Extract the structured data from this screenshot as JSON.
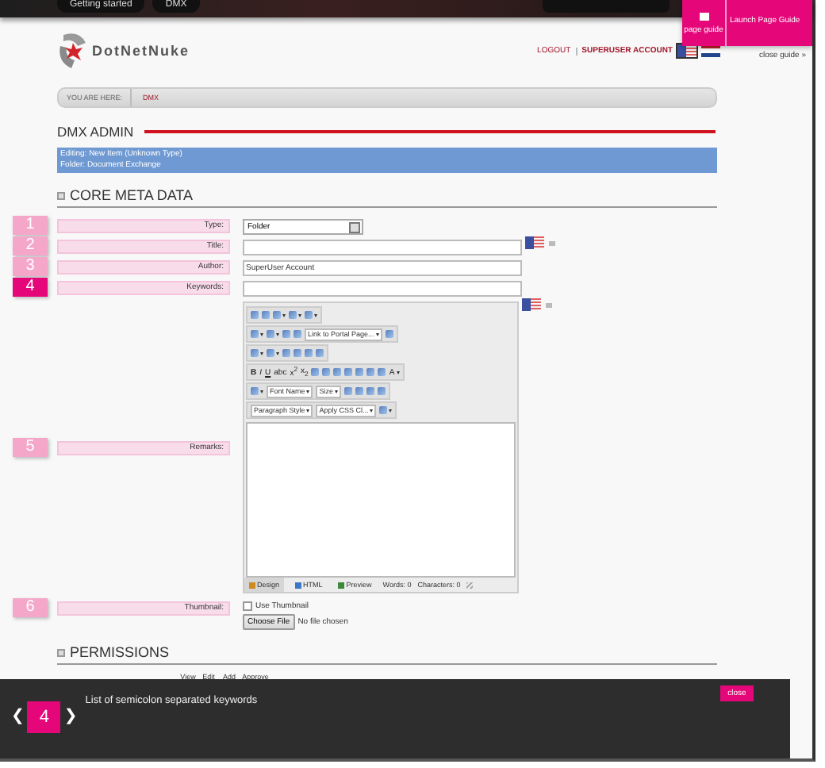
{
  "top_bar": {
    "menu": [
      "Getting started",
      "DMX"
    ]
  },
  "header": {
    "logo": "DotNetNuke",
    "links": [
      "LOGOUT",
      "SUPERUSER ACCOUNT"
    ],
    "languages": [
      {
        "kind": "us",
        "selected": true
      },
      {
        "kind": "nl",
        "selected": false
      }
    ]
  },
  "page_guide": {
    "button": "page guide",
    "launch": "Launch Page Guide",
    "close": "close guide »"
  },
  "breadcrumb": {
    "label": "YOU ARE HERE:",
    "items": [
      "DMX"
    ]
  },
  "title": "DMX ADMIN",
  "info": [
    "Editing: New Item (Unknown Type)",
    "Folder: Document Exchange"
  ],
  "core_meta": {
    "heading": "CORE META DATA",
    "fields": [
      {
        "label": "Type:",
        "kind": "select",
        "value": "Folder",
        "guide": {
          "number": "1",
          "selected": false
        }
      },
      {
        "label": "Title:",
        "kind": "text",
        "flag": true,
        "guide": {
          "number": "2",
          "selected": false
        }
      },
      {
        "label": "Author:",
        "kind": "text",
        "value": "SuperUser Account",
        "guide": {
          "number": "3",
          "selected": false
        }
      },
      {
        "label": "Keywords:",
        "kind": "text",
        "guide": {
          "number": "4",
          "selected": true
        }
      },
      {
        "label": "Remarks:",
        "kind": "editor",
        "flag": true,
        "guide": {
          "number": "5",
          "selected": false
        }
      },
      {
        "label": "Thumbnail:",
        "kind": "file",
        "checkbox": {
          "label": "Use Thumbnail",
          "checked": false
        },
        "button": "Choose File",
        "status": "No file chosen",
        "guide": {
          "number": "6",
          "selected": false
        }
      }
    ]
  },
  "editor": {
    "toolbars": [
      [
        {
          "kind": "button"
        },
        {
          "kind": "button"
        },
        {
          "kind": "menubutton"
        },
        {
          "kind": "menubutton"
        },
        {
          "kind": "menubutton"
        }
      ],
      [
        {
          "kind": "menubutton"
        },
        {
          "kind": "menubutton"
        },
        {
          "kind": "button"
        },
        {
          "kind": "button"
        },
        {
          "kind": "dropdown",
          "label": "Link to Portal Page..."
        },
        {
          "kind": "button"
        }
      ],
      [
        {
          "kind": "menubutton"
        },
        {
          "kind": "menubutton"
        },
        {
          "kind": "button"
        },
        {
          "kind": "button"
        },
        {
          "kind": "button"
        },
        {
          "kind": "button"
        }
      ],
      [
        {
          "kind": "bold",
          "label": "B"
        },
        {
          "kind": "italic",
          "label": "I"
        },
        {
          "kind": "underline",
          "label": "U"
        },
        {
          "kind": "text",
          "label": "abc"
        },
        {
          "kind": "text",
          "label": "x$^{2}$"
        },
        {
          "kind": "text",
          "label": "x$_{2}$"
        },
        {
          "kind": "button"
        },
        {
          "kind": "button"
        },
        {
          "kind": "button"
        },
        {
          "kind": "button"
        },
        {
          "kind": "button"
        },
        {
          "kind": "button"
        },
        {
          "kind": "button"
        },
        {
          "kind": "textmenu",
          "label": "A"
        }
      ],
      [
        {
          "kind": "menubutton"
        },
        {
          "kind": "dropdown",
          "label": "Font Name"
        },
        {
          "kind": "dropdown",
          "label": "Size"
        },
        {
          "kind": "button"
        },
        {
          "kind": "button"
        },
        {
          "kind": "button"
        },
        {
          "kind": "button"
        }
      ],
      [
        {
          "kind": "dropdown",
          "label": "Paragraph Style"
        },
        {
          "kind": "dropdown",
          "label": "Apply CSS Cl..."
        },
        {
          "kind": "menubutton"
        }
      ]
    ],
    "tabs": [
      {
        "label": "Design",
        "selected": true
      },
      {
        "label": "HTML",
        "selected": false
      },
      {
        "label": "Preview",
        "selected": false
      }
    ],
    "words": "Words: 0",
    "characters": "Characters: 0"
  },
  "permissions": {
    "heading": "PERMISSIONS",
    "columns": [
      "View",
      "Edit",
      "Add",
      "Approve"
    ]
  },
  "guide_overlay": {
    "prev": "❮",
    "step": "4",
    "next": "❯",
    "text": "List of semicolon separated keywords",
    "close": "close"
  }
}
